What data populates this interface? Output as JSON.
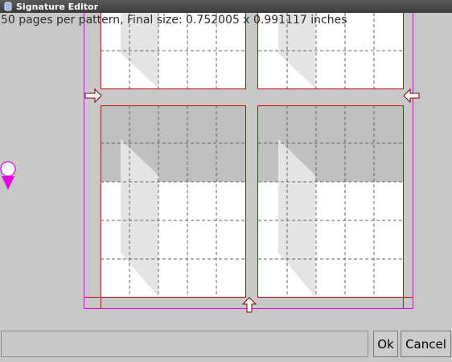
{
  "window": {
    "title": "Signature Editor",
    "icon": "document-icon"
  },
  "canvas": {
    "info_text": "50 pages per pattern, Final size: 0.752005 x 0.991117 inches",
    "colors": {
      "page_border": "#cc0000",
      "margin_guide": "#e000e0",
      "fold_guide": "#666666",
      "arrow": "#7a0000",
      "selection": "#c0c0c0",
      "page_fill": "#ffffff",
      "shadow": "#e4e4e4"
    }
  },
  "footer": {
    "name_value": "",
    "ok_label": "Ok",
    "cancel_label": "Cancel"
  }
}
